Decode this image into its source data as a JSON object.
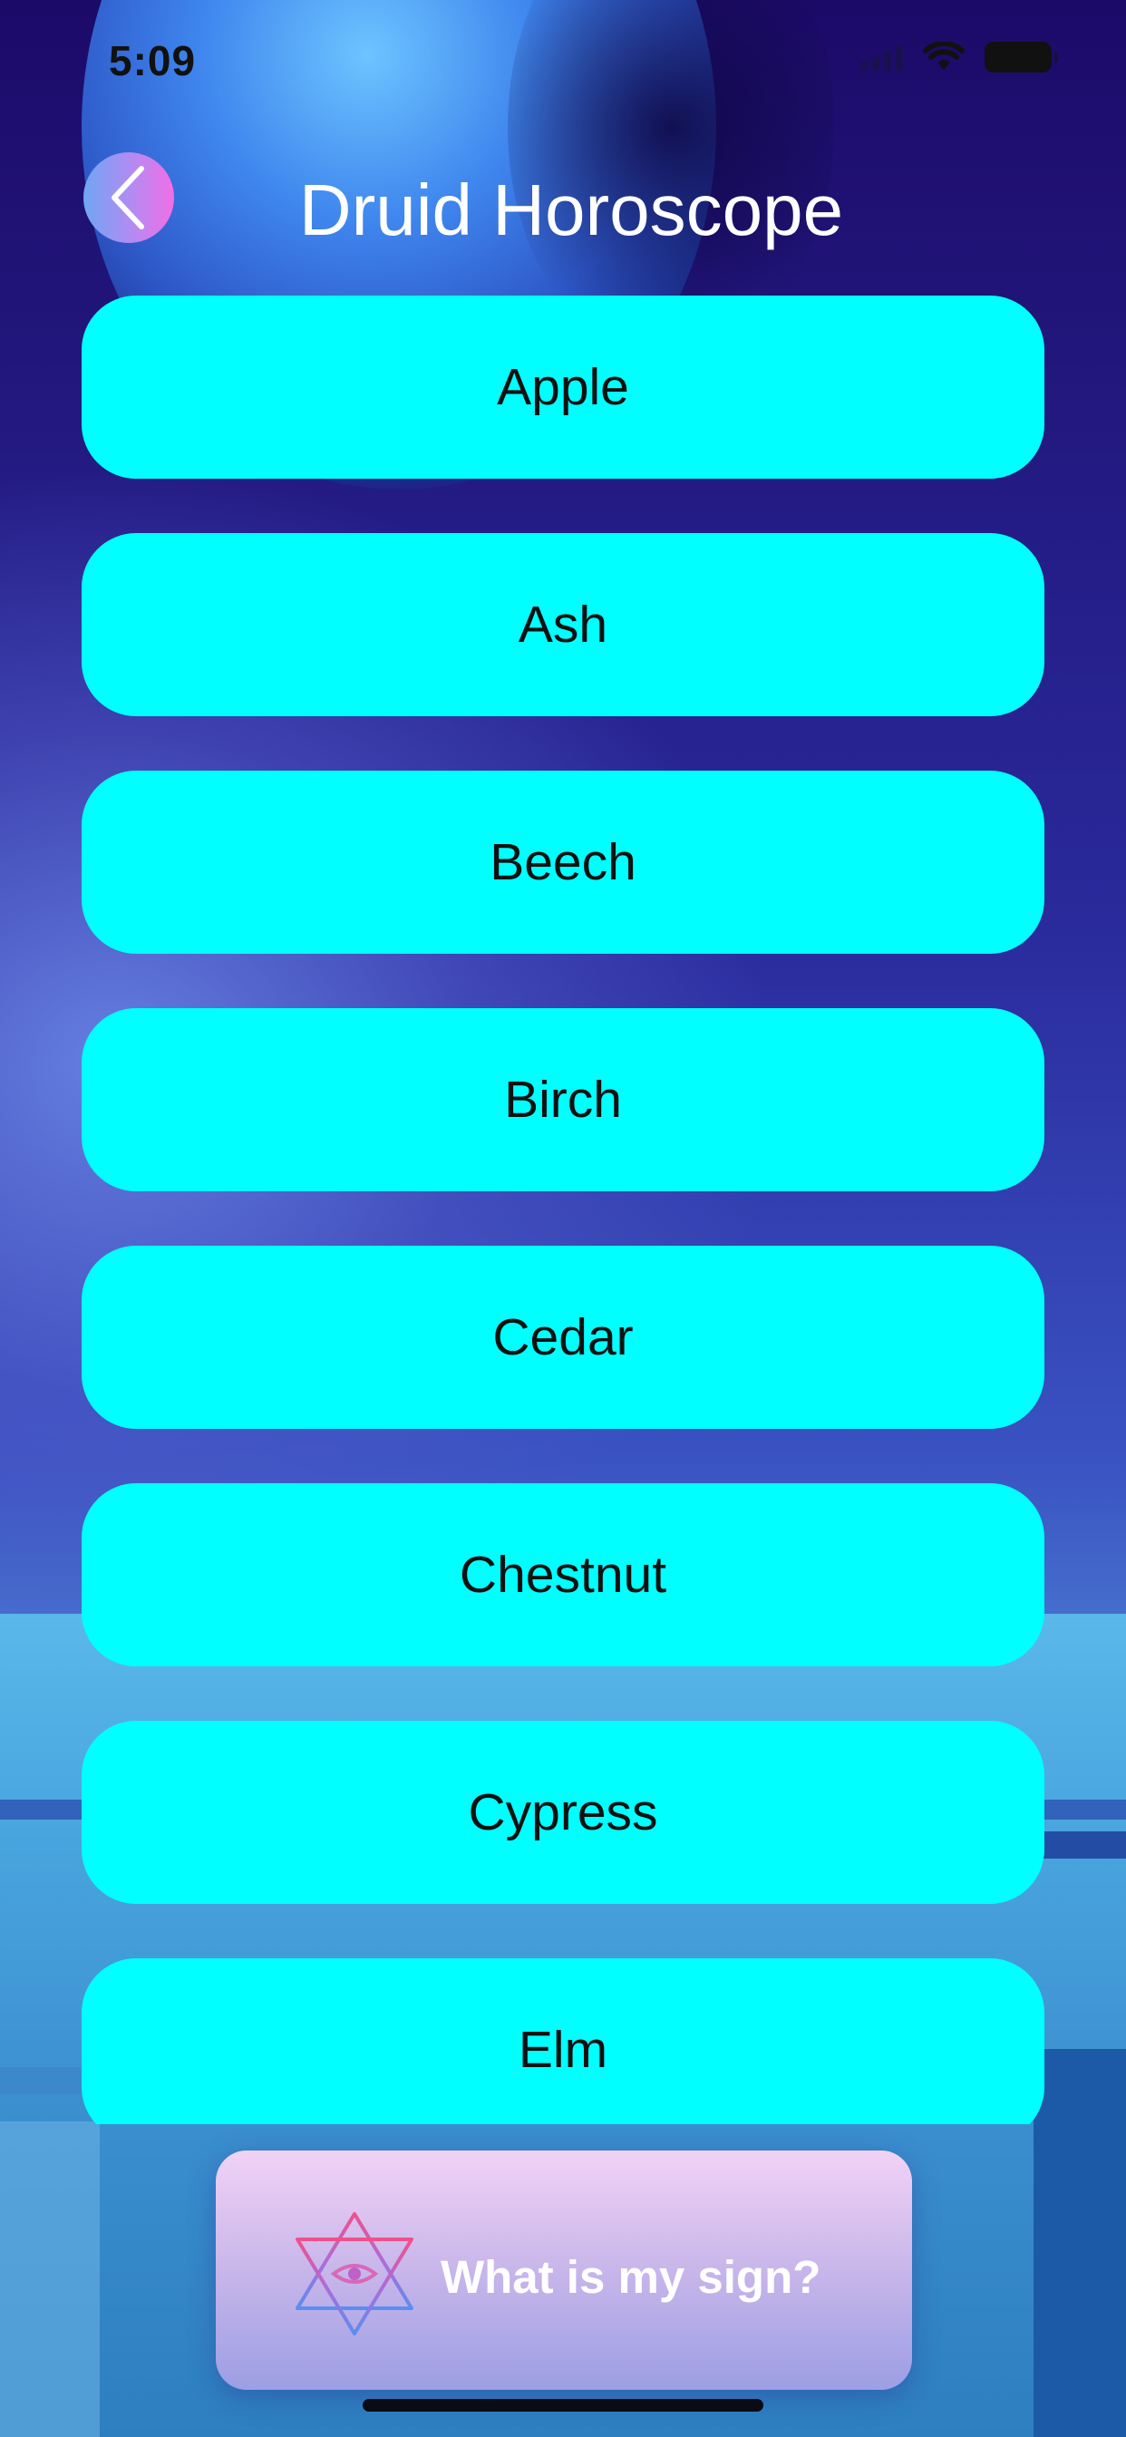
{
  "status_bar": {
    "time": "5:09"
  },
  "header": {
    "title": "Druid Horoscope",
    "back_icon": "chevron-left-icon"
  },
  "signs": [
    {
      "label": "Apple"
    },
    {
      "label": "Ash"
    },
    {
      "label": "Beech"
    },
    {
      "label": "Birch"
    },
    {
      "label": "Cedar"
    },
    {
      "label": "Chestnut"
    },
    {
      "label": "Cypress"
    },
    {
      "label": "Elm"
    }
  ],
  "bottom_action": {
    "label": "What is my sign?",
    "icon": "hexagram-eye-icon"
  },
  "colors": {
    "list_item_bg": "#00ffff",
    "title_text": "#ffffff",
    "back_button_gradient": [
      "#6fa6f4",
      "#f26ee6"
    ]
  }
}
